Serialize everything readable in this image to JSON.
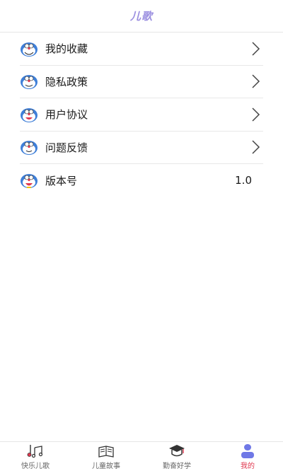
{
  "header": {
    "title": "儿歌"
  },
  "menu": {
    "items": [
      {
        "label": "我的收藏",
        "icon": "doraemon-icon",
        "has_chevron": true
      },
      {
        "label": "隐私政策",
        "icon": "doraemon-icon",
        "has_chevron": true
      },
      {
        "label": "用户协议",
        "icon": "doraemon-icon",
        "has_chevron": true
      },
      {
        "label": "问题反馈",
        "icon": "doraemon-icon",
        "has_chevron": true
      },
      {
        "label": "版本号",
        "icon": "doraemon-icon",
        "value": "1.0"
      }
    ]
  },
  "tabbar": {
    "tabs": [
      {
        "label": "快乐儿歌",
        "icon": "music-note-icon",
        "active": false
      },
      {
        "label": "儿童故事",
        "icon": "book-icon",
        "active": false
      },
      {
        "label": "勤奋好学",
        "icon": "graduation-cap-icon",
        "active": false
      },
      {
        "label": "我的",
        "icon": "user-icon",
        "active": true
      }
    ]
  },
  "colors": {
    "accent": "#e0384f",
    "title": "#9b8fe0",
    "icon_blue": "#3f7fd8"
  }
}
